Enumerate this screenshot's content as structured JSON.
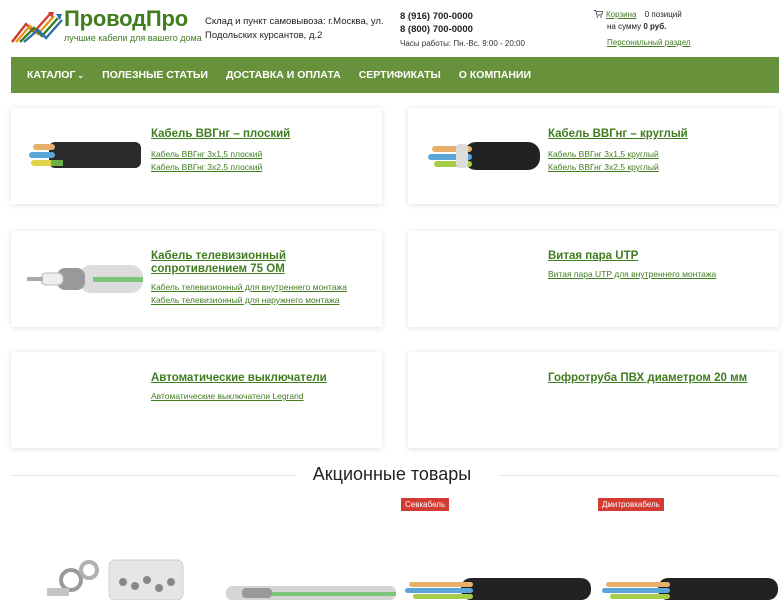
{
  "header": {
    "logo_title": "ПроводПро",
    "logo_subtitle": "лучшие кабели для вашего дома",
    "address_line1": "Склад и пункт самовывоза: г.Москва, ул.",
    "address_line2": "Подольских курсантов, д.2",
    "phone1": "8 (916) 700-0000",
    "phone2": "8 (800) 700-0000",
    "hours": "Часы работы: Пн.-Вс. 9:00 - 20:00",
    "cart_label": "Корзина",
    "cart_count": "0 позиций",
    "cart_sum_prefix": "на сумму",
    "cart_sum": "0 руб.",
    "personal_link": "Персональный раздел"
  },
  "nav": {
    "items": [
      {
        "label": "Каталог"
      },
      {
        "label": "Полезные статьи"
      },
      {
        "label": "Доставка и оплата"
      },
      {
        "label": "Сертификаты"
      },
      {
        "label": "О компании"
      }
    ],
    "catalog_chevron": "⌄"
  },
  "categories": [
    {
      "title": "Кабель ВВГнг – плоский",
      "links": [
        "Кабель ВВГнг 3х1,5 плоский",
        "Кабель ВВГнг 3х2,5 плоский"
      ]
    },
    {
      "title": "Кабель ВВГнг – круглый",
      "links": [
        "Кабель ВВГнг 3х1,5 круглый",
        "Кабель ВВГнг 3х2,5 круглый"
      ]
    },
    {
      "title_line1": "Кабель телевизионный",
      "title_line2": "сопротивлением 75 ОМ",
      "links": [
        "Кабель телевизионный для внутреннего монтажа",
        "Кабель телевизионный для наружнего монтажа"
      ]
    },
    {
      "title": "Витая пара UTP",
      "links": [
        "Витая пара UTP для внутреннего монтажа"
      ]
    },
    {
      "title": "Автоматические выключатели",
      "links": [
        "Автоматические выключатели Legrand"
      ]
    },
    {
      "title": "Гофротруба ПВХ диаметром 20 мм",
      "links": []
    }
  ],
  "section": {
    "title": "Акционные товары"
  },
  "products": [
    {
      "badge": ""
    },
    {
      "badge": ""
    },
    {
      "badge": "Севкабель"
    },
    {
      "badge": "Дмитровкабель"
    }
  ],
  "colors": {
    "brand_green": "#3f7d1f",
    "nav_green": "#68913b",
    "badge_red": "#d23a32"
  }
}
